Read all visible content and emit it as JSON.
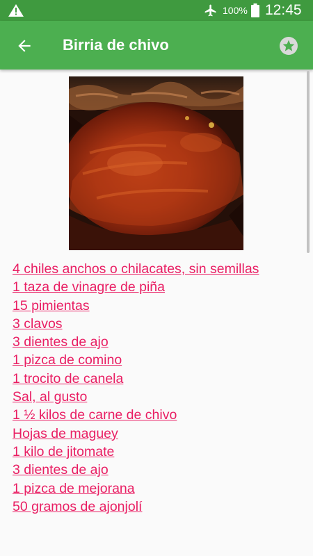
{
  "status_bar": {
    "battery": "100%",
    "time": "12:45",
    "icons": [
      "warning-icon",
      "airplane-mode-icon",
      "battery-icon"
    ]
  },
  "app_bar": {
    "title": "Birria de chivo",
    "back_icon": "arrow-left-icon",
    "favorite_icon": "star-icon"
  },
  "colors": {
    "status_bar": "#3f9a3f",
    "app_bar": "#4caf50",
    "link": "#e91e63",
    "background": "#fafafa"
  },
  "ingredients": [
    "4 chiles anchos o chilacates, sin semillas",
    "1 taza de vinagre de piña",
    "15 pimientas",
    "3 clavos",
    "3 dientes de ajo",
    "1 pizca de comino",
    "1 trocito de canela",
    "Sal, al gusto",
    "1 ½ kilos de carne de chivo",
    "Hojas de maguey",
    "1 kilo de jitomate",
    "3 dientes de ajo",
    "1 pizca de mejorana",
    "50 gramos de ajonjolí"
  ]
}
